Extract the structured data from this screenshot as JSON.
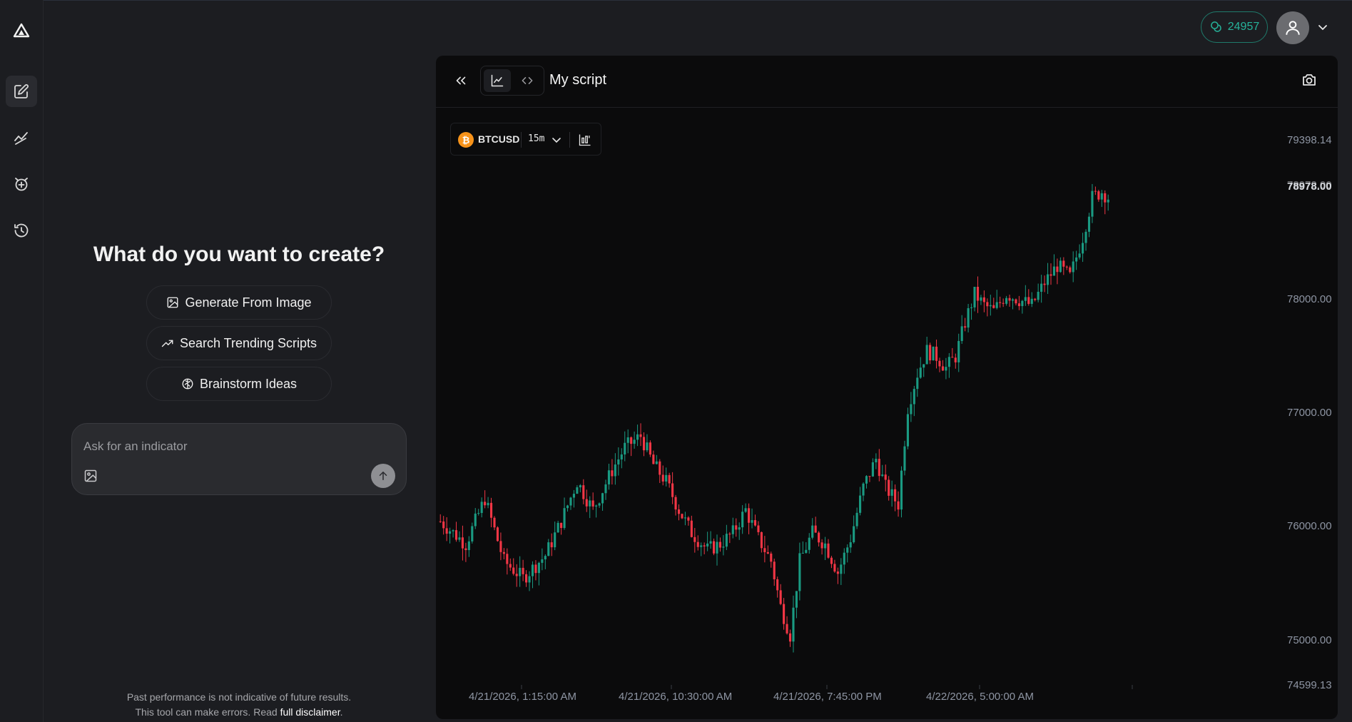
{
  "header": {
    "credits": "24957",
    "accent": "#26b39a"
  },
  "sidebar": {
    "items": [
      {
        "icon": "logo-icon"
      },
      {
        "icon": "edit-icon",
        "active": true
      },
      {
        "icon": "trend-draw-icon"
      },
      {
        "icon": "alarm-add-icon"
      },
      {
        "icon": "history-icon"
      }
    ]
  },
  "main": {
    "headline": "What do you want to create?",
    "actions": [
      {
        "label": "Generate From Image",
        "icon": "image-icon"
      },
      {
        "label": "Search Trending Scripts",
        "icon": "trending-up-icon"
      },
      {
        "label": "Brainstorm Ideas",
        "icon": "brain-icon"
      }
    ],
    "prompt": {
      "placeholder": "Ask for an indicator",
      "value": ""
    },
    "disclaimer_line1": "Past performance is not indicative of future results.",
    "disclaimer_line2": "This tool can make errors. Read ",
    "disclaimer_link": "full disclaimer",
    "disclaimer_end": "."
  },
  "chart_panel": {
    "title": "My script",
    "symbol": "BTCUSD",
    "coin_glyph": "₿",
    "timeframe": "15m",
    "last_price": "78978.00",
    "last_price_overlap": "78972.00"
  },
  "chart_data": {
    "type": "candlestick",
    "symbol": "BTCUSD",
    "interval": "15m",
    "y_ticks": [
      "79398.14",
      "78000.00",
      "77000.00",
      "76000.00",
      "75000.00",
      "74599.13"
    ],
    "x_ticks": [
      "4/21/2026, 1:15:00 AM",
      "4/21/2026, 10:30:00 AM",
      "4/21/2026, 7:45:00 PM",
      "4/22/2026, 5:00:00 AM"
    ],
    "ylim": [
      74599.13,
      79398.14
    ],
    "up_color": "#1a9a82",
    "down_color": "#f23645",
    "close_path": [
      [
        0,
        76050
      ],
      [
        8,
        75850
      ],
      [
        14,
        76250
      ],
      [
        20,
        75700
      ],
      [
        26,
        75550
      ],
      [
        33,
        75750
      ],
      [
        38,
        76050
      ],
      [
        43,
        76400
      ],
      [
        48,
        76150
      ],
      [
        54,
        76500
      ],
      [
        58,
        76700
      ],
      [
        63,
        76800
      ],
      [
        67,
        76550
      ],
      [
        71,
        76400
      ],
      [
        75,
        76150
      ],
      [
        79,
        75950
      ],
      [
        84,
        75800
      ],
      [
        88,
        75850
      ],
      [
        92,
        75950
      ],
      [
        96,
        76150
      ],
      [
        100,
        75900
      ],
      [
        104,
        75700
      ],
      [
        107,
        75300
      ],
      [
        110,
        75050
      ],
      [
        113,
        75700
      ],
      [
        117,
        75950
      ],
      [
        121,
        75850
      ],
      [
        125,
        75600
      ],
      [
        129,
        75900
      ],
      [
        133,
        76350
      ],
      [
        137,
        76600
      ],
      [
        140,
        76350
      ],
      [
        144,
        76200
      ],
      [
        147,
        77050
      ],
      [
        150,
        77350
      ],
      [
        153,
        77550
      ],
      [
        156,
        77500
      ],
      [
        159,
        77400
      ],
      [
        162,
        77500
      ],
      [
        165,
        77800
      ],
      [
        168,
        78050
      ],
      [
        171,
        77950
      ],
      [
        174,
        77900
      ],
      [
        178,
        78050
      ],
      [
        182,
        78000
      ],
      [
        186,
        77950
      ],
      [
        190,
        78150
      ],
      [
        194,
        78300
      ],
      [
        198,
        78200
      ],
      [
        202,
        78550
      ],
      [
        205,
        78900
      ],
      [
        208,
        78950
      ],
      [
        210,
        78900
      ]
    ]
  }
}
